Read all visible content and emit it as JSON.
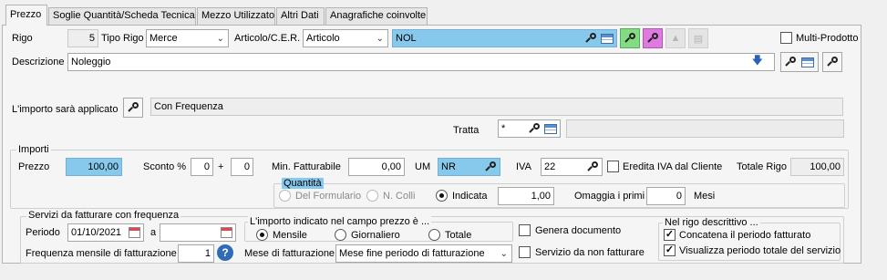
{
  "tabs": [
    "Prezzo",
    "Soglie Quantità/Scheda Tecnica",
    "Mezzo Utilizzato",
    "Altri Dati",
    "Anagrafiche coinvolte"
  ],
  "rigo": {
    "label": "Rigo",
    "value": "5"
  },
  "tipo_rigo": {
    "label": "Tipo Rigo",
    "value": "Merce"
  },
  "articolo": {
    "label": "Articolo/C.E.R.",
    "type_value": "Articolo",
    "code_value": "NOL"
  },
  "multi_prodotto": {
    "label": "Multi-Prodotto",
    "checked": false
  },
  "descrizione": {
    "label": "Descrizione",
    "value": "Noleggio"
  },
  "importo_applicato": {
    "label": "L'importo sarà applicato",
    "value": "Con Frequenza"
  },
  "tratta": {
    "label": "Tratta",
    "value": "*"
  },
  "importi": {
    "title": "Importi",
    "prezzo_label": "Prezzo",
    "prezzo_value": "100,00",
    "sconto_label": "Sconto %",
    "sconto1": "0",
    "plus": "+",
    "sconto2": "0",
    "min_fatt_label": "Min. Fatturabile",
    "min_fatt_value": "0,00",
    "um_label": "UM",
    "um_value": "NR",
    "iva_label": "IVA",
    "iva_value": "22",
    "eredita_label": "Eredita IVA dal Cliente",
    "totale_label": "Totale Rigo",
    "totale_value": "100,00"
  },
  "quantita": {
    "title": "Quantità",
    "opt_formulario": "Del Formulario",
    "opt_ncolli": "N. Colli",
    "opt_indicata": "Indicata",
    "value": "1,00",
    "omaggia_label": "Omaggia i primi",
    "omaggia_value": "0",
    "mesi_label": "Mesi"
  },
  "servizi": {
    "title": "Servizi da fatturare con frequenza",
    "periodo_label": "Periodo",
    "periodo_from": "01/10/2021",
    "a_label": "a",
    "periodo_to": "",
    "frequenza_label": "Frequenza mensile di fatturazione",
    "frequenza_value": "1",
    "help": "?",
    "importo_title": "L'importo indicato nel campo prezzo è ...",
    "opt_mensile": "Mensile",
    "opt_giornaliero": "Giornaliero",
    "opt_totale": "Totale",
    "mese_label": "Mese di fatturazione",
    "mese_value": "Mese fine periodo di fatturazione",
    "genera_label": "Genera documento",
    "servizio_label": "Servizio da non fatturare",
    "rigo_desc_title": "Nel rigo descrittivo ...",
    "concatena_label": "Concatena il periodo fatturato",
    "visualizza_label": "Visualizza periodo totale del servizio"
  },
  "colors": {
    "highlight": "#87c9ec",
    "green_button": "#82dc82",
    "magenta_button": "#e07ae0"
  },
  "icons": [
    "search-icon",
    "table-icon",
    "calendar-icon",
    "help-icon",
    "arrow-down-icon"
  ]
}
